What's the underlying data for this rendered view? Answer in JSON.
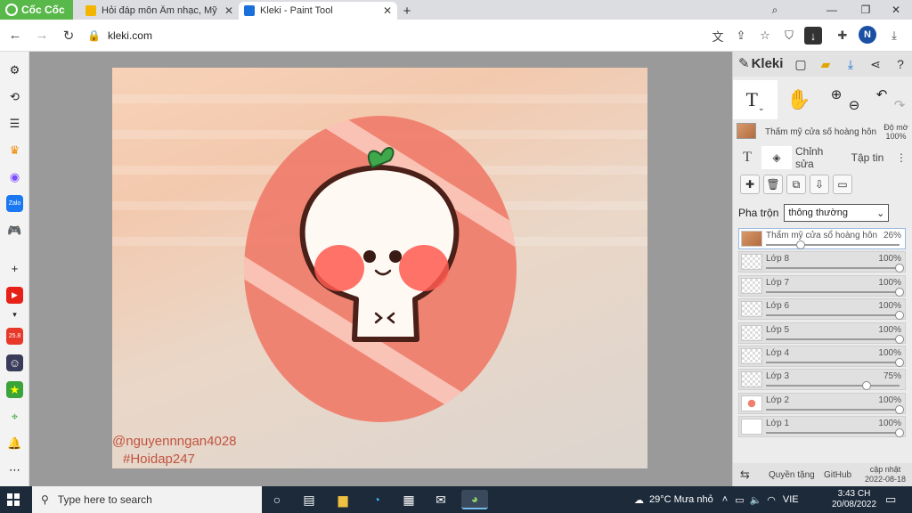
{
  "browser": {
    "brand_label": "Cốc Cốc",
    "tabs": [
      {
        "title": "Hỏi đáp môn Âm nhạc, Mỹ thuật",
        "icon": "hoidap-favicon",
        "active": false
      },
      {
        "title": "Kleki - Paint Tool",
        "icon": "kleki-favicon",
        "active": true
      }
    ],
    "url": "kleki.com",
    "profile_initial": "N"
  },
  "canvas": {
    "credit_line1": "@nguyennngan4028",
    "credit_line2": "#Hoidap247"
  },
  "kleki": {
    "logo": "Kleki",
    "current_layer_name": "Thẩm mỹ cửa sổ hoàng hôn",
    "opacity_label": "Độ mờ",
    "opacity_value": "100%",
    "tabs": {
      "adjust": "Chỉnh sửa",
      "file": "Tập tin"
    },
    "blend_label": "Pha trộn",
    "blend_value": "thông thường",
    "layers": [
      {
        "name": "Thẩm mỹ cửa sổ hoàng hôn",
        "opacity": "26%",
        "level": 0.26,
        "selected": true
      },
      {
        "name": "Lớp 8",
        "opacity": "100%",
        "level": 1.0
      },
      {
        "name": "Lớp 7",
        "opacity": "100%",
        "level": 1.0
      },
      {
        "name": "Lớp 6",
        "opacity": "100%",
        "level": 1.0
      },
      {
        "name": "Lớp 5",
        "opacity": "100%",
        "level": 1.0
      },
      {
        "name": "Lớp 4",
        "opacity": "100%",
        "level": 1.0
      },
      {
        "name": "Lớp 3",
        "opacity": "75%",
        "level": 0.75
      },
      {
        "name": "Lớp 2",
        "opacity": "100%",
        "level": 1.0
      },
      {
        "name": "Lớp 1",
        "opacity": "100%",
        "level": 1.0
      }
    ],
    "footer": {
      "privacy": "Quyền tặng",
      "github": "GitHub",
      "update_label": "cập nhật",
      "update_date": "2022-08-18"
    }
  },
  "taskbar": {
    "search_placeholder": "Type here to search",
    "weather": "29°C  Mưa nhỏ",
    "language": "VIE",
    "time": "3:43 CH",
    "date": "20/08/2022"
  }
}
